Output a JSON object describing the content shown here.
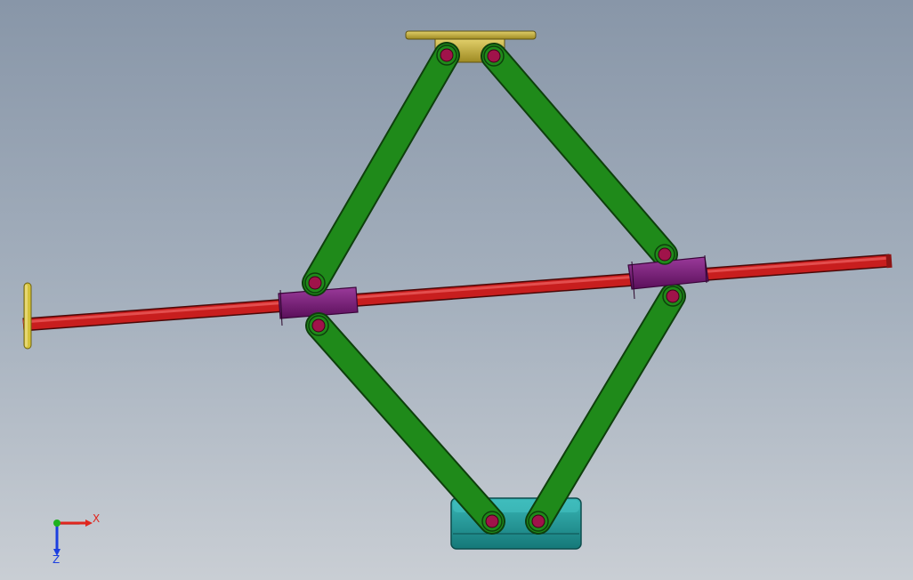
{
  "viewport": {
    "background_top": "#8896a8",
    "background_bottom": "#c9ced4"
  },
  "model": {
    "arm_color": "#1f8a1a",
    "arm_edge": "#0e3f0c",
    "pin_color": "#a0134a",
    "screw_color": "#c81e1e",
    "nut_color": "#7a1a7a",
    "top_plate_color": "#c9b13b",
    "base_color": "#1e9a9a",
    "handle_color": "#d4c23a"
  },
  "triad": {
    "x_label": "X",
    "z_label": "Z",
    "x_color": "#e0261e",
    "y_color": "#1fb21f",
    "z_color": "#1c3fe0"
  }
}
